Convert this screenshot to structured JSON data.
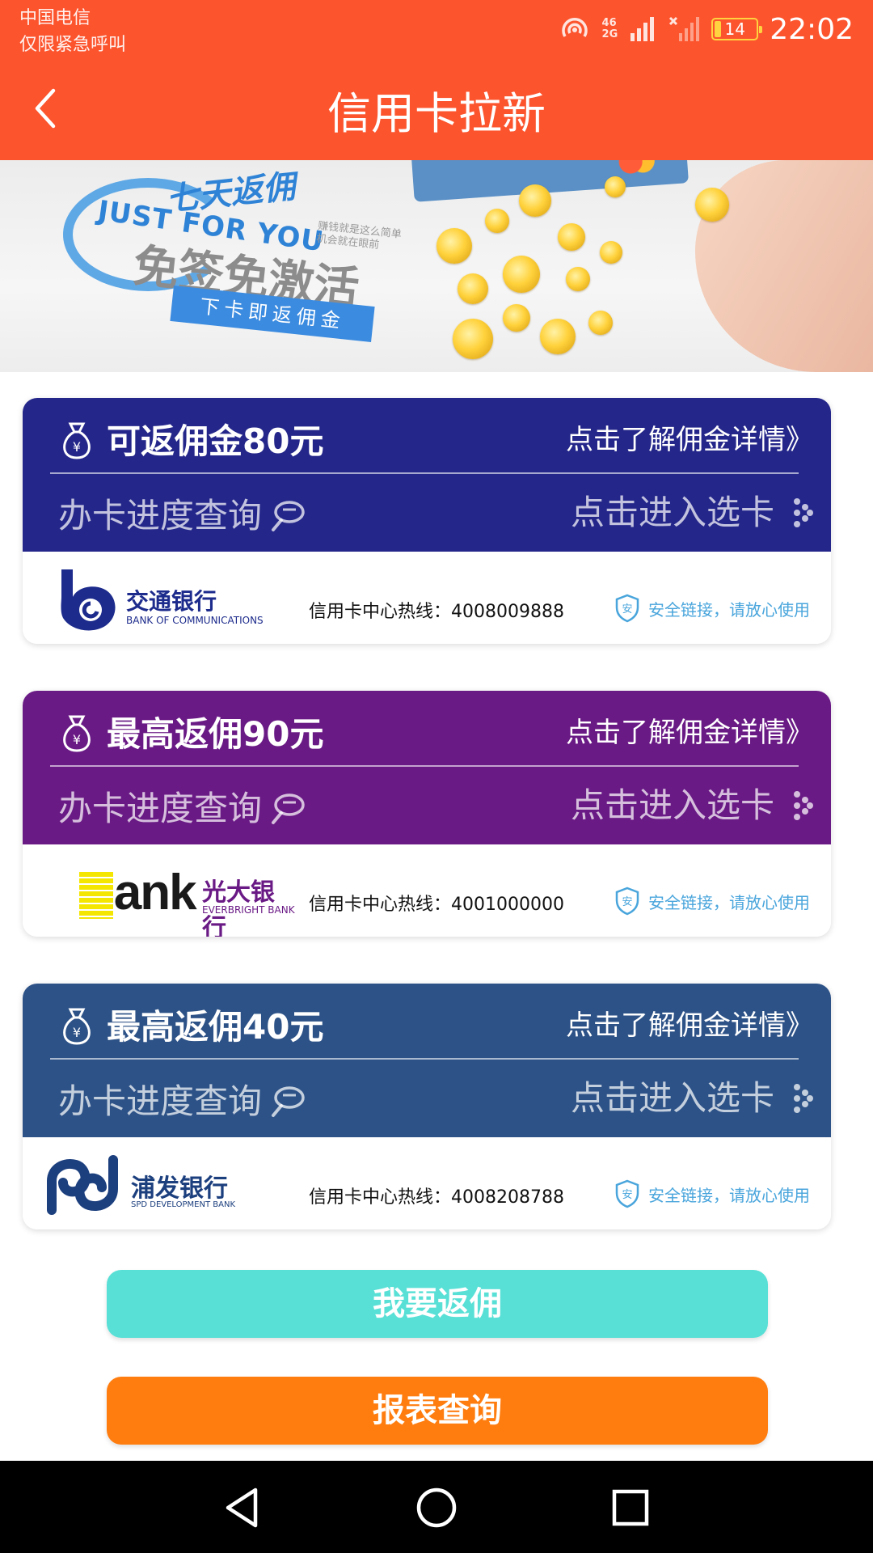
{
  "status_bar": {
    "carrier_line1": "中国电信",
    "carrier_line2": "仅限紧急呼叫",
    "network_top": "46",
    "network_bottom": "2G",
    "battery": "14",
    "time": "22:02"
  },
  "header": {
    "title": "信用卡拉新",
    "background_color": "#fc542d"
  },
  "banner": {
    "headline": "七天返佣",
    "slogan": "JUST FOR YOU",
    "tagline": "赚钱就是这么简单 机会就在眼前",
    "main_text": "免签免激活",
    "ribbon": "下卡即返佣金"
  },
  "cards": [
    {
      "commission": "可返佣金80元",
      "detail_link": "点击了解佣金详情》",
      "progress_query": "办卡进度查询",
      "choose_card": "点击进入选卡",
      "bank_name_cn": "交通银行",
      "bank_name_en": "BANK OF COMMUNICATIONS",
      "hotline": "信用卡中心热线：4008009888",
      "secure_text": "安全链接，请放心使用",
      "head_color": "#24268a"
    },
    {
      "commission": "最高返佣90元",
      "detail_link": "点击了解佣金详情》",
      "progress_query": "办卡进度查询",
      "choose_card": "点击进入选卡",
      "bank_logo_word": "Bank",
      "bank_name_cn": "光大银行",
      "bank_name_en": "EVERBRIGHT BANK",
      "hotline": "信用卡中心热线：4001000000",
      "secure_text": "安全链接，请放心使用",
      "head_color": "#6a1a85"
    },
    {
      "commission": "最高返佣40元",
      "detail_link": "点击了解佣金详情》",
      "progress_query": "办卡进度查询",
      "choose_card": "点击进入选卡",
      "bank_name_cn": "浦发银行",
      "bank_name_en": "SPD DEVELOPMENT BANK",
      "hotline": "信用卡中心热线：4008208788",
      "secure_text": "安全链接，请放心使用",
      "head_color": "#2d5287"
    }
  ],
  "shield_glyph": "安",
  "currency_glyph": "¥",
  "buttons": {
    "rebate": "我要返佣",
    "report": "报表查询"
  },
  "nav": {
    "back_icon": "triangle-back-icon",
    "home_icon": "circle-home-icon",
    "recents_icon": "square-recents-icon"
  }
}
